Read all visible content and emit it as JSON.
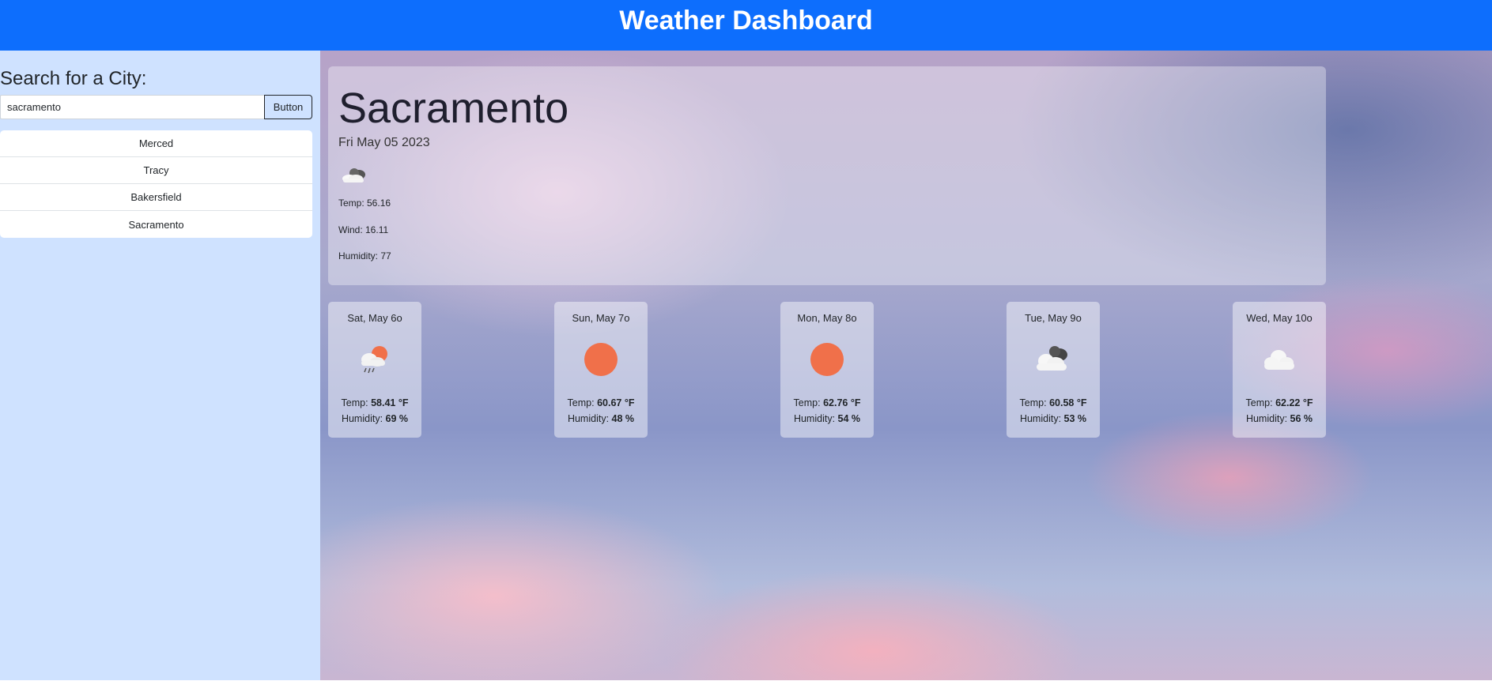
{
  "header": {
    "title": "Weather Dashboard"
  },
  "sidebar": {
    "search_title": "Search for a City:",
    "search_value": "sacramento",
    "button_label": "Button",
    "history": [
      "Merced",
      "Tracy",
      "Bakersfield",
      "Sacramento"
    ]
  },
  "current": {
    "city": "Sacramento",
    "date": "Fri May 05 2023",
    "icon": "cloud-dark-icon",
    "temp": "Temp: 56.16",
    "wind": "Wind: 16.11",
    "humidity": "Humidity: 77"
  },
  "forecast": [
    {
      "day": "Sat, May 6o",
      "icon": "rain-sun-icon",
      "temp_label": "Temp: ",
      "temp": "58.41 °F",
      "hum_label": "Humidity: ",
      "humidity": "69 %"
    },
    {
      "day": "Sun, May 7o",
      "icon": "sun-icon",
      "temp_label": "Temp: ",
      "temp": "60.67 °F",
      "hum_label": "Humidity: ",
      "humidity": "48 %"
    },
    {
      "day": "Mon, May 8o",
      "icon": "sun-icon",
      "temp_label": "Temp: ",
      "temp": "62.76 °F",
      "hum_label": "Humidity: ",
      "humidity": "54 %"
    },
    {
      "day": "Tue, May 9o",
      "icon": "dark-clouds-icon",
      "temp_label": "Temp: ",
      "temp": "60.58 °F",
      "hum_label": "Humidity: ",
      "humidity": "53 %"
    },
    {
      "day": "Wed, May 10o",
      "icon": "cloud-icon",
      "temp_label": "Temp: ",
      "temp": "62.22 °F",
      "hum_label": "Humidity: ",
      "humidity": "56 %"
    }
  ],
  "colors": {
    "header": "#0d6efd",
    "sidebar": "#cfe2ff",
    "sun": "#f0704a"
  }
}
